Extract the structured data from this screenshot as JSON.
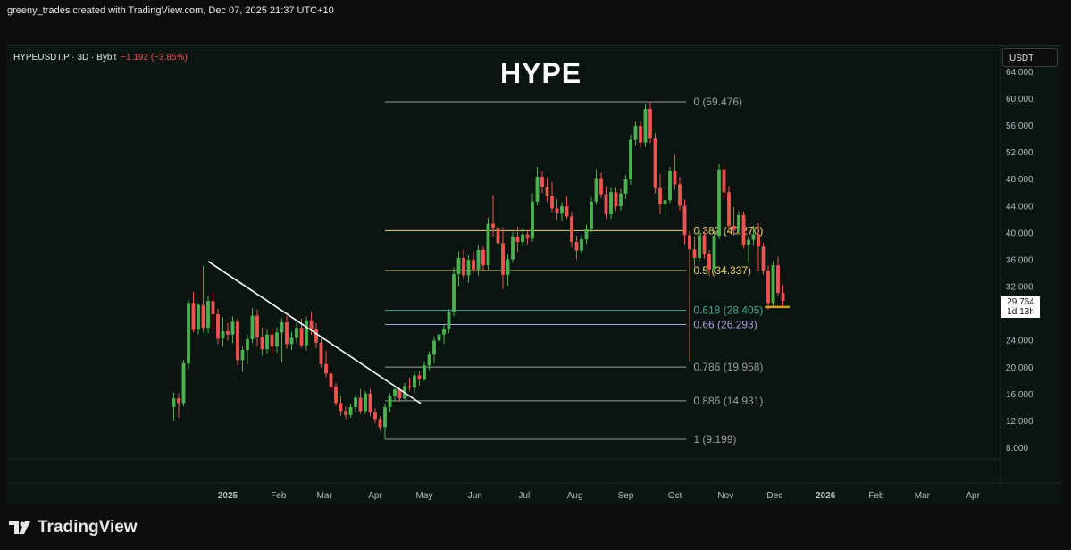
{
  "header": {
    "credit": "greeny_trades created with TradingView.com, Dec 07, 2025 21:37 UTC+10"
  },
  "symbol": {
    "name": "HYPEUSDT.P · 3D · Bybit",
    "change": "−1.192 (−3.85%)"
  },
  "currency": "USDT",
  "current_price": {
    "price": "29.764",
    "countdown": "1d 13h"
  },
  "brand": {
    "name": "TradingView"
  },
  "colors": {
    "up": "#26a69a",
    "up_candle": "#4caf50",
    "down": "#ef5350",
    "fib_gray": "#9e9e9e",
    "fib_yellow": "#e6d36a",
    "fib_teal": "#4fa39a",
    "fib_purple": "#b39ddb",
    "trendline": "#ffffff",
    "support": "#c9a227"
  },
  "chart_data": {
    "type": "candlestick",
    "title": "HYPE",
    "y_ticks": [
      "64.000",
      "60.000",
      "56.000",
      "52.000",
      "48.000",
      "44.000",
      "40.000",
      "36.000",
      "32.000",
      "28.000",
      "24.000",
      "20.000",
      "16.000",
      "12.000",
      "8.000"
    ],
    "y_tick_values": [
      64,
      60,
      56,
      52,
      48,
      44,
      40,
      36,
      32,
      28,
      24,
      20,
      16,
      12,
      8
    ],
    "ylim": [
      7,
      65.5
    ],
    "x_ticks": [
      "2025",
      "Feb",
      "Mar",
      "Apr",
      "May",
      "Jun",
      "Jul",
      "Aug",
      "Sep",
      "Oct",
      "Nov",
      "Dec",
      "2026",
      "Feb",
      "Mar",
      "Apr"
    ],
    "x_tick_dates": [
      "2025-01-01",
      "2025-02-01",
      "2025-03-01",
      "2025-04-01",
      "2025-05-01",
      "2025-06-01",
      "2025-07-01",
      "2025-08-01",
      "2025-09-01",
      "2025-10-01",
      "2025-11-01",
      "2025-12-01",
      "2026-01-01",
      "2026-02-01",
      "2026-03-01",
      "2026-04-01"
    ],
    "bold_x_ticks": [
      "2025",
      "2026"
    ],
    "fib_levels": [
      {
        "label": "0 (59.476)",
        "value": 59.476,
        "color": "#9e9e9e"
      },
      {
        "label": "0.382 (40.270)",
        "value": 40.27,
        "color": "#e6d36a"
      },
      {
        "label": "0.5 (34.337)",
        "value": 34.337,
        "color": "#e6d36a"
      },
      {
        "label": "0.618 (28.405)",
        "value": 28.405,
        "color": "#4fa39a"
      },
      {
        "label": "0.66 (26.293)",
        "value": 26.293,
        "color": "#b39ddb"
      },
      {
        "label": "0.786 (19.958)",
        "value": 19.958,
        "color": "#9e9e9e"
      },
      {
        "label": "0.886 (14.931)",
        "value": 14.931,
        "color": "#9e9e9e"
      },
      {
        "label": "1 (9.199)",
        "value": 9.199,
        "color": "#9e9e9e"
      }
    ],
    "fib_start_date": "2025-04-07",
    "fib_end_date": "2025-10-08",
    "trendline": {
      "from": {
        "date": "2024-12-20",
        "value": 35.7
      },
      "to": {
        "date": "2025-04-29",
        "value": 14.5
      }
    },
    "support_line": {
      "from": {
        "date": "2025-11-25",
        "value": 28.9
      },
      "to": {
        "date": "2025-12-10",
        "value": 28.9
      }
    },
    "candles": [
      {
        "d": "2024-11-29",
        "o": 14.0,
        "h": 16.2,
        "l": 12.0,
        "c": 15.3
      },
      {
        "d": "2024-12-02",
        "o": 15.3,
        "h": 16.0,
        "l": 12.4,
        "c": 14.6
      },
      {
        "d": "2024-12-05",
        "o": 14.6,
        "h": 21.0,
        "l": 14.1,
        "c": 20.5
      },
      {
        "d": "2024-12-08",
        "o": 20.5,
        "h": 30.0,
        "l": 19.6,
        "c": 29.5
      },
      {
        "d": "2024-12-11",
        "o": 29.5,
        "h": 31.2,
        "l": 25.1,
        "c": 25.5
      },
      {
        "d": "2024-12-14",
        "o": 25.5,
        "h": 29.5,
        "l": 24.8,
        "c": 29.2
      },
      {
        "d": "2024-12-17",
        "o": 29.2,
        "h": 35.0,
        "l": 25.1,
        "c": 25.8
      },
      {
        "d": "2024-12-20",
        "o": 25.8,
        "h": 30.5,
        "l": 25.0,
        "c": 29.8
      },
      {
        "d": "2024-12-23",
        "o": 29.8,
        "h": 31.0,
        "l": 25.5,
        "c": 27.8
      },
      {
        "d": "2024-12-26",
        "o": 27.8,
        "h": 28.6,
        "l": 23.4,
        "c": 24.2
      },
      {
        "d": "2024-12-29",
        "o": 24.2,
        "h": 27.4,
        "l": 23.0,
        "c": 25.3
      },
      {
        "d": "2025-01-01",
        "o": 25.3,
        "h": 26.5,
        "l": 23.9,
        "c": 24.8
      },
      {
        "d": "2025-01-04",
        "o": 24.8,
        "h": 27.5,
        "l": 23.5,
        "c": 26.7
      },
      {
        "d": "2025-01-07",
        "o": 26.7,
        "h": 27.2,
        "l": 20.2,
        "c": 21.0
      },
      {
        "d": "2025-01-10",
        "o": 21.0,
        "h": 23.1,
        "l": 19.2,
        "c": 22.5
      },
      {
        "d": "2025-01-13",
        "o": 22.5,
        "h": 24.8,
        "l": 20.4,
        "c": 24.1
      },
      {
        "d": "2025-01-16",
        "o": 24.1,
        "h": 28.7,
        "l": 23.5,
        "c": 27.6
      },
      {
        "d": "2025-01-19",
        "o": 27.6,
        "h": 28.5,
        "l": 23.0,
        "c": 24.4
      },
      {
        "d": "2025-01-22",
        "o": 24.4,
        "h": 25.8,
        "l": 21.7,
        "c": 22.6
      },
      {
        "d": "2025-01-25",
        "o": 22.6,
        "h": 25.5,
        "l": 22.0,
        "c": 24.8
      },
      {
        "d": "2025-01-28",
        "o": 24.8,
        "h": 25.6,
        "l": 21.9,
        "c": 23.0
      },
      {
        "d": "2025-01-31",
        "o": 23.0,
        "h": 25.9,
        "l": 22.1,
        "c": 25.1
      },
      {
        "d": "2025-02-03",
        "o": 25.1,
        "h": 27.2,
        "l": 20.6,
        "c": 26.6
      },
      {
        "d": "2025-02-06",
        "o": 26.6,
        "h": 27.6,
        "l": 22.7,
        "c": 23.4
      },
      {
        "d": "2025-02-09",
        "o": 23.4,
        "h": 25.2,
        "l": 22.5,
        "c": 24.3
      },
      {
        "d": "2025-02-12",
        "o": 24.3,
        "h": 26.6,
        "l": 23.5,
        "c": 25.8
      },
      {
        "d": "2025-02-15",
        "o": 25.8,
        "h": 27.2,
        "l": 22.8,
        "c": 23.2
      },
      {
        "d": "2025-02-18",
        "o": 23.2,
        "h": 27.4,
        "l": 22.4,
        "c": 26.9
      },
      {
        "d": "2025-02-21",
        "o": 26.9,
        "h": 28.2,
        "l": 24.8,
        "c": 25.6
      },
      {
        "d": "2025-02-24",
        "o": 25.6,
        "h": 26.5,
        "l": 22.8,
        "c": 23.6
      },
      {
        "d": "2025-02-27",
        "o": 23.6,
        "h": 24.4,
        "l": 19.9,
        "c": 20.4
      },
      {
        "d": "2025-03-02",
        "o": 20.4,
        "h": 22.4,
        "l": 18.4,
        "c": 19.0
      },
      {
        "d": "2025-03-05",
        "o": 19.0,
        "h": 19.6,
        "l": 16.4,
        "c": 17.0
      },
      {
        "d": "2025-03-08",
        "o": 17.0,
        "h": 17.6,
        "l": 14.2,
        "c": 14.6
      },
      {
        "d": "2025-03-11",
        "o": 14.6,
        "h": 15.7,
        "l": 12.7,
        "c": 13.4
      },
      {
        "d": "2025-03-14",
        "o": 13.4,
        "h": 14.1,
        "l": 12.2,
        "c": 12.8
      },
      {
        "d": "2025-03-17",
        "o": 12.8,
        "h": 14.5,
        "l": 12.4,
        "c": 14.0
      },
      {
        "d": "2025-03-20",
        "o": 14.0,
        "h": 15.8,
        "l": 13.2,
        "c": 15.4
      },
      {
        "d": "2025-03-23",
        "o": 15.4,
        "h": 16.7,
        "l": 13.0,
        "c": 13.4
      },
      {
        "d": "2025-03-26",
        "o": 13.4,
        "h": 16.4,
        "l": 13.0,
        "c": 16.0
      },
      {
        "d": "2025-03-29",
        "o": 16.0,
        "h": 16.7,
        "l": 12.6,
        "c": 13.2
      },
      {
        "d": "2025-04-01",
        "o": 13.2,
        "h": 13.8,
        "l": 11.6,
        "c": 12.2
      },
      {
        "d": "2025-04-04",
        "o": 12.2,
        "h": 12.6,
        "l": 10.5,
        "c": 11.0
      },
      {
        "d": "2025-04-07",
        "o": 11.0,
        "h": 14.5,
        "l": 9.2,
        "c": 14.0
      },
      {
        "d": "2025-04-10",
        "o": 14.0,
        "h": 16.0,
        "l": 13.2,
        "c": 15.6
      },
      {
        "d": "2025-04-13",
        "o": 15.6,
        "h": 17.2,
        "l": 14.8,
        "c": 16.6
      },
      {
        "d": "2025-04-16",
        "o": 16.6,
        "h": 16.9,
        "l": 14.8,
        "c": 15.3
      },
      {
        "d": "2025-04-19",
        "o": 15.3,
        "h": 17.6,
        "l": 15.0,
        "c": 17.1
      },
      {
        "d": "2025-04-22",
        "o": 17.1,
        "h": 18.4,
        "l": 16.4,
        "c": 16.9
      },
      {
        "d": "2025-04-25",
        "o": 16.9,
        "h": 19.2,
        "l": 16.1,
        "c": 18.7
      },
      {
        "d": "2025-04-28",
        "o": 18.7,
        "h": 19.3,
        "l": 17.2,
        "c": 18.1
      },
      {
        "d": "2025-05-01",
        "o": 18.1,
        "h": 20.8,
        "l": 17.8,
        "c": 20.2
      },
      {
        "d": "2025-05-04",
        "o": 20.2,
        "h": 22.3,
        "l": 19.5,
        "c": 21.8
      },
      {
        "d": "2025-05-07",
        "o": 21.8,
        "h": 24.5,
        "l": 20.5,
        "c": 23.9
      },
      {
        "d": "2025-05-10",
        "o": 23.9,
        "h": 25.4,
        "l": 22.7,
        "c": 24.8
      },
      {
        "d": "2025-05-13",
        "o": 24.8,
        "h": 26.2,
        "l": 23.4,
        "c": 25.6
      },
      {
        "d": "2025-05-16",
        "o": 25.6,
        "h": 28.6,
        "l": 25.0,
        "c": 28.1
      },
      {
        "d": "2025-05-19",
        "o": 28.1,
        "h": 34.8,
        "l": 27.5,
        "c": 33.8
      },
      {
        "d": "2025-05-22",
        "o": 33.8,
        "h": 37.2,
        "l": 32.0,
        "c": 36.2
      },
      {
        "d": "2025-05-25",
        "o": 36.2,
        "h": 37.5,
        "l": 33.0,
        "c": 33.6
      },
      {
        "d": "2025-05-28",
        "o": 33.6,
        "h": 36.6,
        "l": 32.5,
        "c": 35.9
      },
      {
        "d": "2025-05-31",
        "o": 35.9,
        "h": 37.2,
        "l": 33.9,
        "c": 34.5
      },
      {
        "d": "2025-06-03",
        "o": 34.5,
        "h": 38.2,
        "l": 33.6,
        "c": 37.4
      },
      {
        "d": "2025-06-06",
        "o": 37.4,
        "h": 38.0,
        "l": 34.4,
        "c": 35.1
      },
      {
        "d": "2025-06-09",
        "o": 35.1,
        "h": 42.2,
        "l": 34.5,
        "c": 41.3
      },
      {
        "d": "2025-06-12",
        "o": 41.3,
        "h": 45.6,
        "l": 39.4,
        "c": 40.7
      },
      {
        "d": "2025-06-15",
        "o": 40.7,
        "h": 41.6,
        "l": 37.6,
        "c": 38.4
      },
      {
        "d": "2025-06-18",
        "o": 38.4,
        "h": 40.8,
        "l": 31.6,
        "c": 33.7
      },
      {
        "d": "2025-06-21",
        "o": 33.7,
        "h": 36.8,
        "l": 32.1,
        "c": 36.0
      },
      {
        "d": "2025-06-24",
        "o": 36.0,
        "h": 40.1,
        "l": 35.5,
        "c": 39.4
      },
      {
        "d": "2025-06-27",
        "o": 39.4,
        "h": 40.9,
        "l": 37.1,
        "c": 38.6
      },
      {
        "d": "2025-06-30",
        "o": 38.6,
        "h": 40.7,
        "l": 38.0,
        "c": 39.7
      },
      {
        "d": "2025-07-03",
        "o": 39.7,
        "h": 40.4,
        "l": 38.2,
        "c": 39.1
      },
      {
        "d": "2025-07-06",
        "o": 39.1,
        "h": 45.8,
        "l": 38.6,
        "c": 44.6
      },
      {
        "d": "2025-07-09",
        "o": 44.6,
        "h": 49.8,
        "l": 44.0,
        "c": 48.3
      },
      {
        "d": "2025-07-12",
        "o": 48.3,
        "h": 49.1,
        "l": 45.9,
        "c": 46.8
      },
      {
        "d": "2025-07-15",
        "o": 46.8,
        "h": 48.2,
        "l": 44.5,
        "c": 45.4
      },
      {
        "d": "2025-07-18",
        "o": 45.4,
        "h": 47.5,
        "l": 42.9,
        "c": 43.6
      },
      {
        "d": "2025-07-21",
        "o": 43.6,
        "h": 45.0,
        "l": 41.9,
        "c": 42.8
      },
      {
        "d": "2025-07-24",
        "o": 42.8,
        "h": 44.5,
        "l": 41.6,
        "c": 43.9
      },
      {
        "d": "2025-07-27",
        "o": 43.9,
        "h": 45.4,
        "l": 42.0,
        "c": 42.4
      },
      {
        "d": "2025-07-30",
        "o": 42.4,
        "h": 43.1,
        "l": 37.8,
        "c": 38.6
      },
      {
        "d": "2025-08-02",
        "o": 38.6,
        "h": 39.5,
        "l": 36.0,
        "c": 37.3
      },
      {
        "d": "2025-08-05",
        "o": 37.3,
        "h": 39.6,
        "l": 36.9,
        "c": 39.0
      },
      {
        "d": "2025-08-08",
        "o": 39.0,
        "h": 41.2,
        "l": 38.3,
        "c": 40.6
      },
      {
        "d": "2025-08-11",
        "o": 40.6,
        "h": 45.2,
        "l": 40.0,
        "c": 44.6
      },
      {
        "d": "2025-08-14",
        "o": 44.6,
        "h": 49.4,
        "l": 44.1,
        "c": 48.1
      },
      {
        "d": "2025-08-17",
        "o": 48.1,
        "h": 48.9,
        "l": 45.1,
        "c": 45.7
      },
      {
        "d": "2025-08-20",
        "o": 45.7,
        "h": 46.8,
        "l": 42.0,
        "c": 42.7
      },
      {
        "d": "2025-08-23",
        "o": 42.7,
        "h": 46.6,
        "l": 42.0,
        "c": 46.0
      },
      {
        "d": "2025-08-26",
        "o": 46.0,
        "h": 46.7,
        "l": 43.2,
        "c": 43.9
      },
      {
        "d": "2025-08-29",
        "o": 43.9,
        "h": 46.5,
        "l": 43.3,
        "c": 45.8
      },
      {
        "d": "2025-09-01",
        "o": 45.8,
        "h": 48.6,
        "l": 45.0,
        "c": 47.9
      },
      {
        "d": "2025-09-04",
        "o": 47.9,
        "h": 54.6,
        "l": 47.1,
        "c": 53.8
      },
      {
        "d": "2025-09-07",
        "o": 53.8,
        "h": 56.5,
        "l": 53.0,
        "c": 55.9
      },
      {
        "d": "2025-09-10",
        "o": 55.9,
        "h": 56.5,
        "l": 52.7,
        "c": 53.4
      },
      {
        "d": "2025-09-13",
        "o": 53.4,
        "h": 59.2,
        "l": 52.7,
        "c": 58.4
      },
      {
        "d": "2025-09-16",
        "o": 58.4,
        "h": 59.5,
        "l": 53.3,
        "c": 54.0
      },
      {
        "d": "2025-09-19",
        "o": 54.0,
        "h": 54.8,
        "l": 45.8,
        "c": 46.6
      },
      {
        "d": "2025-09-22",
        "o": 46.6,
        "h": 48.7,
        "l": 42.7,
        "c": 44.2
      },
      {
        "d": "2025-09-25",
        "o": 44.2,
        "h": 46.0,
        "l": 42.5,
        "c": 44.8
      },
      {
        "d": "2025-09-28",
        "o": 44.8,
        "h": 49.8,
        "l": 44.4,
        "c": 49.1
      },
      {
        "d": "2025-10-01",
        "o": 49.1,
        "h": 51.6,
        "l": 46.4,
        "c": 47.2
      },
      {
        "d": "2025-10-04",
        "o": 47.2,
        "h": 48.3,
        "l": 43.3,
        "c": 44.0
      },
      {
        "d": "2025-10-07",
        "o": 44.0,
        "h": 44.9,
        "l": 38.2,
        "c": 39.6
      },
      {
        "d": "2025-10-10",
        "o": 39.6,
        "h": 40.2,
        "l": 20.8,
        "c": 37.5
      },
      {
        "d": "2025-10-13",
        "o": 37.5,
        "h": 39.4,
        "l": 35.0,
        "c": 36.2
      },
      {
        "d": "2025-10-16",
        "o": 36.2,
        "h": 40.4,
        "l": 35.6,
        "c": 39.6
      },
      {
        "d": "2025-10-19",
        "o": 39.6,
        "h": 40.2,
        "l": 36.1,
        "c": 36.8
      },
      {
        "d": "2025-10-22",
        "o": 36.8,
        "h": 37.4,
        "l": 33.5,
        "c": 34.5
      },
      {
        "d": "2025-10-25",
        "o": 34.5,
        "h": 40.3,
        "l": 34.0,
        "c": 39.5
      },
      {
        "d": "2025-10-28",
        "o": 39.5,
        "h": 50.2,
        "l": 39.0,
        "c": 49.4
      },
      {
        "d": "2025-10-31",
        "o": 49.4,
        "h": 50.0,
        "l": 45.2,
        "c": 46.0
      },
      {
        "d": "2025-11-03",
        "o": 46.0,
        "h": 46.9,
        "l": 40.0,
        "c": 41.0
      },
      {
        "d": "2025-11-06",
        "o": 41.0,
        "h": 43.8,
        "l": 39.5,
        "c": 40.3
      },
      {
        "d": "2025-11-09",
        "o": 40.3,
        "h": 43.2,
        "l": 39.6,
        "c": 42.6
      },
      {
        "d": "2025-11-12",
        "o": 42.6,
        "h": 43.1,
        "l": 37.6,
        "c": 38.2
      },
      {
        "d": "2025-11-15",
        "o": 38.2,
        "h": 39.5,
        "l": 35.4,
        "c": 38.9
      },
      {
        "d": "2025-11-18",
        "o": 38.9,
        "h": 41.0,
        "l": 38.1,
        "c": 39.7
      },
      {
        "d": "2025-11-21",
        "o": 39.7,
        "h": 41.4,
        "l": 34.2,
        "c": 37.9
      },
      {
        "d": "2025-11-24",
        "o": 37.9,
        "h": 38.4,
        "l": 33.7,
        "c": 34.3
      },
      {
        "d": "2025-11-27",
        "o": 34.3,
        "h": 35.1,
        "l": 28.5,
        "c": 29.5
      },
      {
        "d": "2025-11-30",
        "o": 29.5,
        "h": 35.7,
        "l": 28.9,
        "c": 35.1
      },
      {
        "d": "2025-12-03",
        "o": 35.1,
        "h": 36.4,
        "l": 30.6,
        "c": 31.0
      },
      {
        "d": "2025-12-06",
        "o": 31.0,
        "h": 32.2,
        "l": 29.0,
        "c": 29.8
      }
    ]
  }
}
